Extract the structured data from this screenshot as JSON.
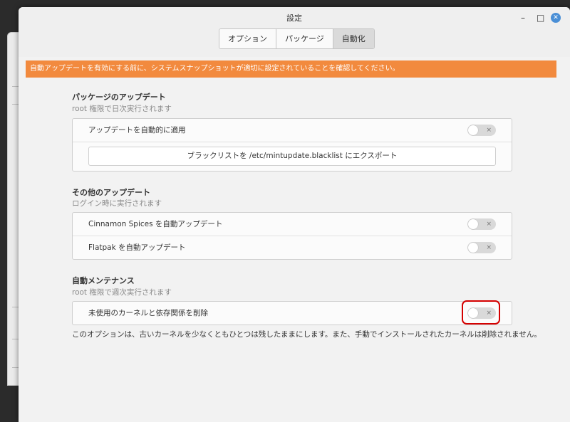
{
  "window": {
    "title": "設定"
  },
  "tabs": [
    {
      "label": "オプション",
      "active": false
    },
    {
      "label": "パッケージ",
      "active": false
    },
    {
      "label": "自動化",
      "active": true
    }
  ],
  "warning": "自動アップデートを有効にする前に、システムスナップショットが適切に設定されていることを確認してください。",
  "sections": {
    "package_updates": {
      "title": "パッケージのアップデート",
      "subtitle": "root 権限で日次実行されます",
      "rows": [
        {
          "label": "アップデートを自動的に適用",
          "enabled": false
        }
      ],
      "export_button": "ブラックリストを /etc/mintupdate.blacklist にエクスポート"
    },
    "other_updates": {
      "title": "その他のアップデート",
      "subtitle": "ログイン時に実行されます",
      "rows": [
        {
          "label": "Cinnamon Spices を自動アップデート",
          "enabled": false
        },
        {
          "label": "Flatpak を自動アップデート",
          "enabled": false
        }
      ]
    },
    "maintenance": {
      "title": "自動メンテナンス",
      "subtitle": "root 権限で週次実行されます",
      "rows": [
        {
          "label": "未使用のカーネルと依存関係を削除",
          "enabled": false
        }
      ],
      "note": "このオプションは、古いカーネルを少なくともひとつは残したままにします。また、手動でインストールされたカーネルは削除されません。"
    }
  },
  "toggle_off_symbol": "×",
  "colors": {
    "warning_bg": "#f28a3e",
    "highlight": "#d40000",
    "close_button": "#4a8fd6"
  }
}
